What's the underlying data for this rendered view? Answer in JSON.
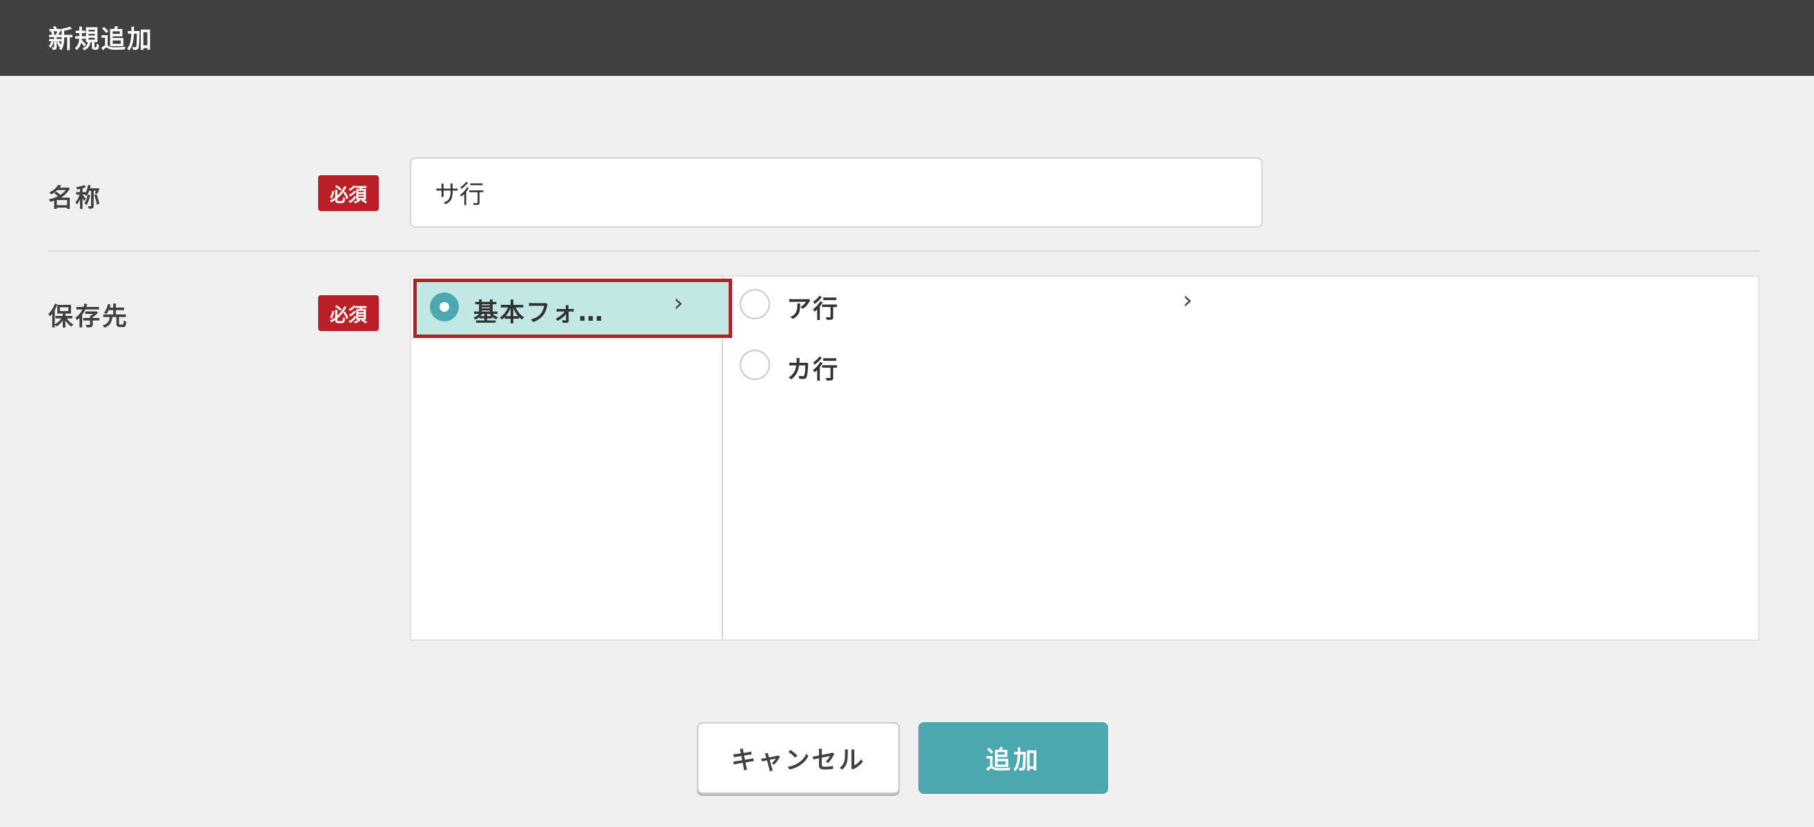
{
  "header": {
    "title": "新規追加"
  },
  "form": {
    "name": {
      "label": "名称",
      "required_badge": "必須",
      "value": "サ行"
    },
    "destination": {
      "label": "保存先",
      "required_badge": "必須"
    }
  },
  "tree": {
    "column1": {
      "selected_item": {
        "label": "基本フォ…",
        "chevron": "›"
      }
    },
    "column2": {
      "items": [
        {
          "label": "ア行",
          "chevron": "›"
        },
        {
          "label": "カ行"
        }
      ]
    }
  },
  "buttons": {
    "cancel_label": "キャンセル",
    "add_label": "追加"
  },
  "colors": {
    "header_bg": "#404040",
    "accent_teal": "#4aa8ae",
    "selected_row_bg": "#c2e8e6",
    "required_red": "#b82025",
    "highlight_border": "#b41e24"
  },
  "icons": {
    "selected_radio": "radio-checked-icon",
    "unselected_radio": "radio-unchecked-icon",
    "expand": "chevron-right-icon"
  }
}
